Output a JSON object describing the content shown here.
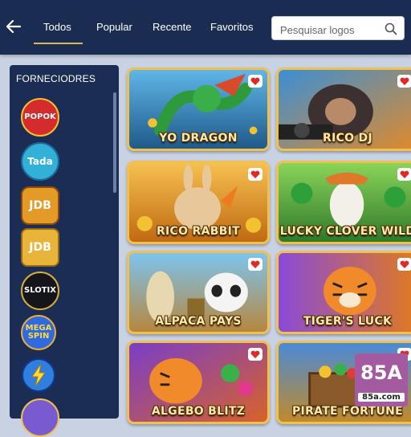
{
  "header": {
    "back_icon": "arrow-left-icon",
    "tabs": [
      {
        "label": "Todos",
        "active": true
      },
      {
        "label": "Popular",
        "active": false
      },
      {
        "label": "Recente",
        "active": false
      },
      {
        "label": "Favoritos",
        "active": false
      }
    ],
    "search": {
      "placeholder": "Pesquisar logos",
      "value": "",
      "icon": "search-icon"
    }
  },
  "sidebar": {
    "title": "FORNECIODRES",
    "providers": [
      {
        "name": "POPOK",
        "color": "#d42c2c"
      },
      {
        "name": "Tada",
        "color": "#32b0d8"
      },
      {
        "name": "JDB",
        "color": "#e49a26"
      },
      {
        "name": "JDB",
        "color": "#e8b53a"
      },
      {
        "name": "SLOTIX",
        "color": "#15151c"
      },
      {
        "name": "MEGA SPIN",
        "color": "#2f6ae0"
      },
      {
        "name": "",
        "icon": "lightning-icon",
        "color": "#2f7fe0"
      }
    ]
  },
  "games": [
    {
      "title": "YO DRAGON",
      "favorite": true,
      "colors": [
        "#4aa0d8",
        "#2c7a3a"
      ]
    },
    {
      "title": "RICO DJ",
      "favorite": true,
      "colors": [
        "#3b8fd6",
        "#e08a2a"
      ]
    },
    {
      "title": "RICO RABBIT",
      "favorite": true,
      "colors": [
        "#f0a830",
        "#c96a16"
      ]
    },
    {
      "title": "LUCKY CLOVER WILD",
      "favorite": true,
      "colors": [
        "#6cc04a",
        "#2f7a2a"
      ]
    },
    {
      "title": "ALPACA PAYS",
      "favorite": true,
      "colors": [
        "#67b6e8",
        "#b6873e"
      ]
    },
    {
      "title": "TIGER'S LUCK",
      "favorite": true,
      "colors": [
        "#8a4ad8",
        "#e07a20"
      ]
    },
    {
      "title": "ALGEBO BLITZ",
      "favorite": true,
      "colors": [
        "#7a3ec8",
        "#d8622a"
      ]
    },
    {
      "title": "PIRATE FORTUNE",
      "favorite": true,
      "colors": [
        "#4a8ad8",
        "#c08a2a"
      ]
    }
  ],
  "watermark": {
    "big": "85A",
    "small": "85a.com"
  }
}
